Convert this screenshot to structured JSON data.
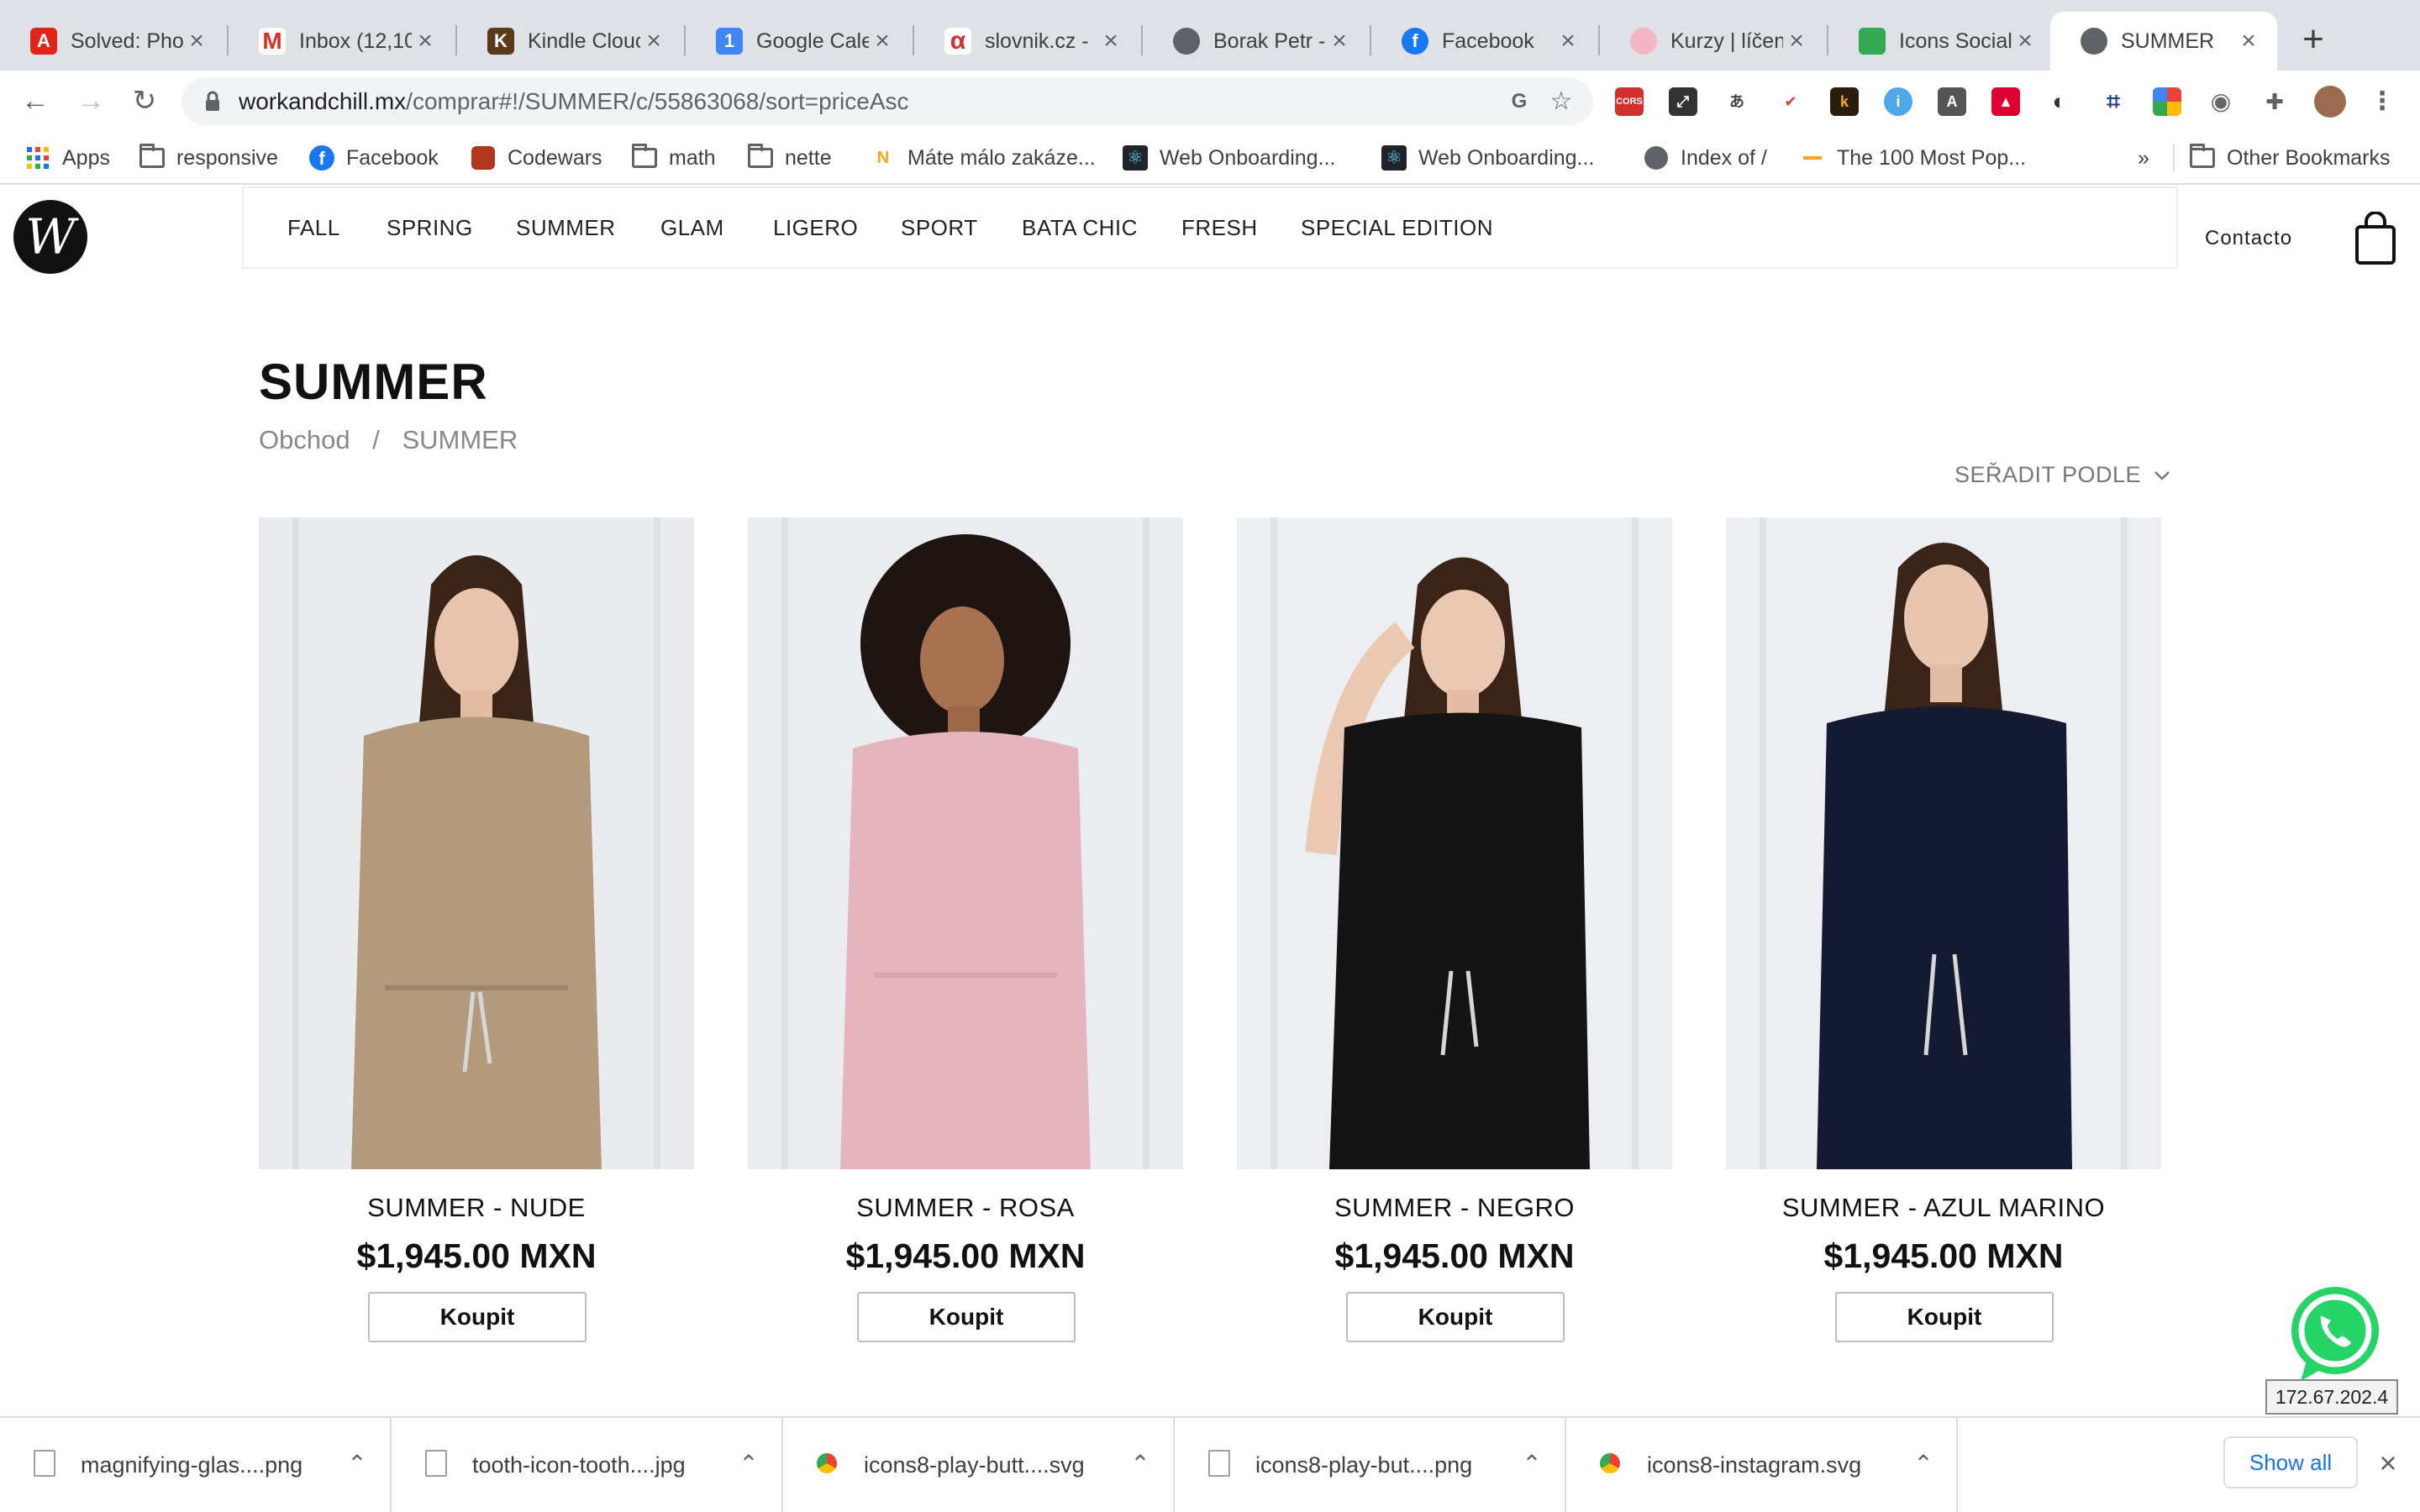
{
  "browser": {
    "tabs": [
      {
        "label": "Solved: Phot",
        "icon": "adobe-icon",
        "color": "#e0261b"
      },
      {
        "label": "Inbox (12,10",
        "icon": "gmail-icon",
        "color": "#d93025"
      },
      {
        "label": "Kindle Clouc",
        "icon": "kindle-icon",
        "color": "#5a3a1a"
      },
      {
        "label": "Google Cale",
        "icon": "google-calendar-icon",
        "color": "#4285f4"
      },
      {
        "label": "slovnik.cz -",
        "icon": "slovnik-icon",
        "color": "#d32f2f"
      },
      {
        "label": "Borak Petr -",
        "icon": "globe-icon",
        "color": "#5f6368"
      },
      {
        "label": "Facebook",
        "icon": "facebook-icon",
        "color": "#1877f2"
      },
      {
        "label": "Kurzy | líčen",
        "icon": "makeup-icon",
        "color": "#f4b6c2"
      },
      {
        "label": "Icons Social",
        "icon": "icons8-icon",
        "color": "#35a853"
      },
      {
        "label": "SUMMER",
        "icon": "globe-icon",
        "color": "#5f6368",
        "active": true
      }
    ],
    "url_host": "workandchill.mx",
    "url_path": "/comprar#!/SUMMER/c/55863068/sort=priceAsc",
    "extensions": [
      "cors-icon",
      "fullscreen-icon",
      "translate-icon",
      "todoist-icon",
      "k-icon",
      "info-icon",
      "a-icon",
      "angular-icon",
      "dark-mode-icon",
      "crop-icon",
      "google-icon",
      "circle-icon",
      "puzzle-icon",
      "profile-avatar"
    ],
    "extension_labels": {
      "cors": "CORS",
      "k": "k",
      "info": "i",
      "a": "A"
    },
    "bookmarks": [
      {
        "label": "Apps",
        "icon": "apps-grid-icon"
      },
      {
        "label": "responsive",
        "icon": "folder-icon"
      },
      {
        "label": "Facebook",
        "icon": "facebook-icon"
      },
      {
        "label": "Codewars",
        "icon": "codewars-icon"
      },
      {
        "label": "math",
        "icon": "folder-icon"
      },
      {
        "label": "nette",
        "icon": "folder-icon"
      },
      {
        "label": "Máte málo zakáze...",
        "icon": "n-icon"
      },
      {
        "label": "Web Onboarding...",
        "icon": "react-icon"
      },
      {
        "label": "Web Onboarding...",
        "icon": "react-icon"
      },
      {
        "label": "Index of /",
        "icon": "globe-icon"
      },
      {
        "label": "The 100 Most Pop...",
        "icon": "dash-icon"
      }
    ],
    "bookmarks_overflow": "»",
    "other_bookmarks": "Other Bookmarks"
  },
  "site": {
    "logo_letter": "W",
    "nav": [
      "FALL",
      "SPRING",
      "SUMMER",
      "GLAM",
      "LIGERO",
      "SPORT",
      "BATA CHIC",
      "FRESH",
      "SPECIAL EDITION"
    ],
    "contact": "Contacto",
    "page_title": "SUMMER",
    "breadcrumb": [
      "Obchod",
      "/",
      "SUMMER"
    ],
    "sort_label": "SEŘADIT PODLE",
    "products": [
      {
        "name": "SUMMER - NUDE",
        "price": "$1,945.00 MXN",
        "button": "Koupit",
        "color": "#b49a7c"
      },
      {
        "name": "SUMMER - ROSA",
        "price": "$1,945.00 MXN",
        "button": "Koupit",
        "color": "#e5b5bd"
      },
      {
        "name": "SUMMER - NEGRO",
        "price": "$1,945.00 MXN",
        "button": "Koupit",
        "color": "#141414"
      },
      {
        "name": "SUMMER - AZUL MARINO",
        "price": "$1,945.00 MXN",
        "button": "Koupit",
        "color": "#151a33"
      }
    ],
    "ip_label": "172.67.202.4"
  },
  "downloads": {
    "items": [
      {
        "name": "magnifying-glas....png",
        "type": "file"
      },
      {
        "name": "tooth-icon-tooth....jpg",
        "type": "file"
      },
      {
        "name": "icons8-play-butt....svg",
        "type": "chrome"
      },
      {
        "name": "icons8-play-but....png",
        "type": "file"
      },
      {
        "name": "icons8-instagram.svg",
        "type": "chrome"
      }
    ],
    "show_all": "Show all"
  }
}
